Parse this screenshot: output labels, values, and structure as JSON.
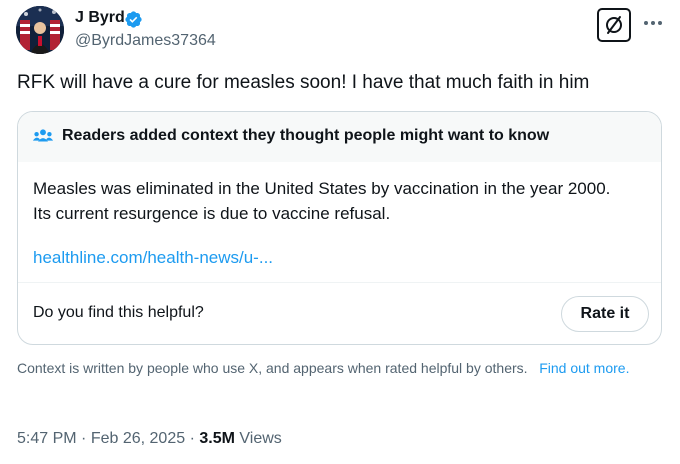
{
  "author": {
    "name": "J Byrd",
    "handle": "@ByrdJames37364",
    "verified_color": "#1d9bf0"
  },
  "header_actions": {
    "grok_icon": "grok-icon",
    "more_icon": "more-dots-icon"
  },
  "tweet": {
    "text": "RFK will have a cure for measles soon! I have that much faith in him"
  },
  "community_note": {
    "header_icon": "people-icon",
    "header_text": "Readers added context they thought people might want to know",
    "body_lines": [
      "Measles was eliminated in the United States by vaccination in the year 2000.",
      "Its current resurgence is due to vaccine refusal."
    ],
    "link_text": "healthline.com/health-news/u-...",
    "helpful_question": "Do you find this helpful?",
    "rate_button_label": "Rate it"
  },
  "disclaimer": {
    "text": "Context is written by people who use X, and appears when rated helpful by others.",
    "link_text": "Find out more."
  },
  "meta": {
    "time": "5:47 PM",
    "separator": "·",
    "date": "Feb 26, 2025",
    "views_count": "3.5M",
    "views_label": "Views"
  },
  "colors": {
    "text": "#0f1419",
    "secondary_text": "#536471",
    "link": "#1d9bf0",
    "border": "#cfd9de",
    "note_header_bg": "#f7f9f9"
  }
}
